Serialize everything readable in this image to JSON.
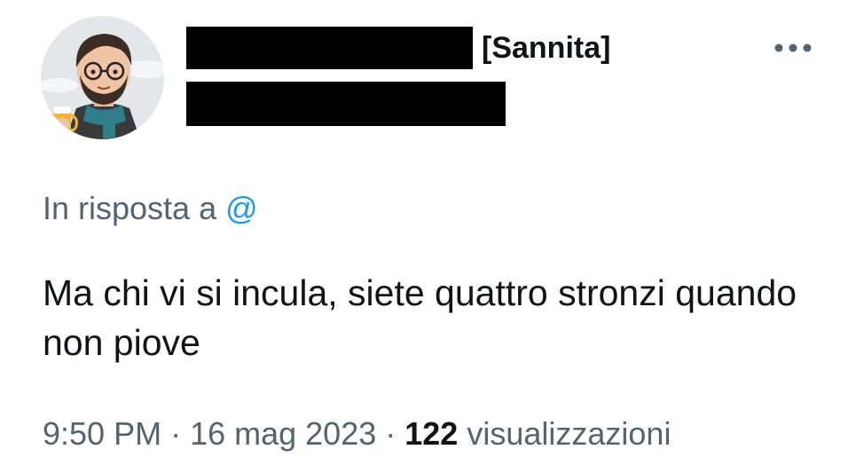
{
  "tweet": {
    "author": {
      "name_suffix": "[Sannita]",
      "avatar_icon": "cartoon-bearded-man-avatar"
    },
    "more_icon": "more-horizontal-icon",
    "reply": {
      "prefix": "In risposta a",
      "mention": "@"
    },
    "text": "Ma chi vi si incula, siete quattro stronzi quando non piove",
    "meta": {
      "time": "9:50 PM",
      "separator": "·",
      "date": "16 mag 2023",
      "views_count": "122",
      "views_label": "visualizzazioni"
    }
  },
  "colors": {
    "text_primary": "#0f1419",
    "text_secondary": "#536471",
    "link": "#1d9bf0"
  }
}
